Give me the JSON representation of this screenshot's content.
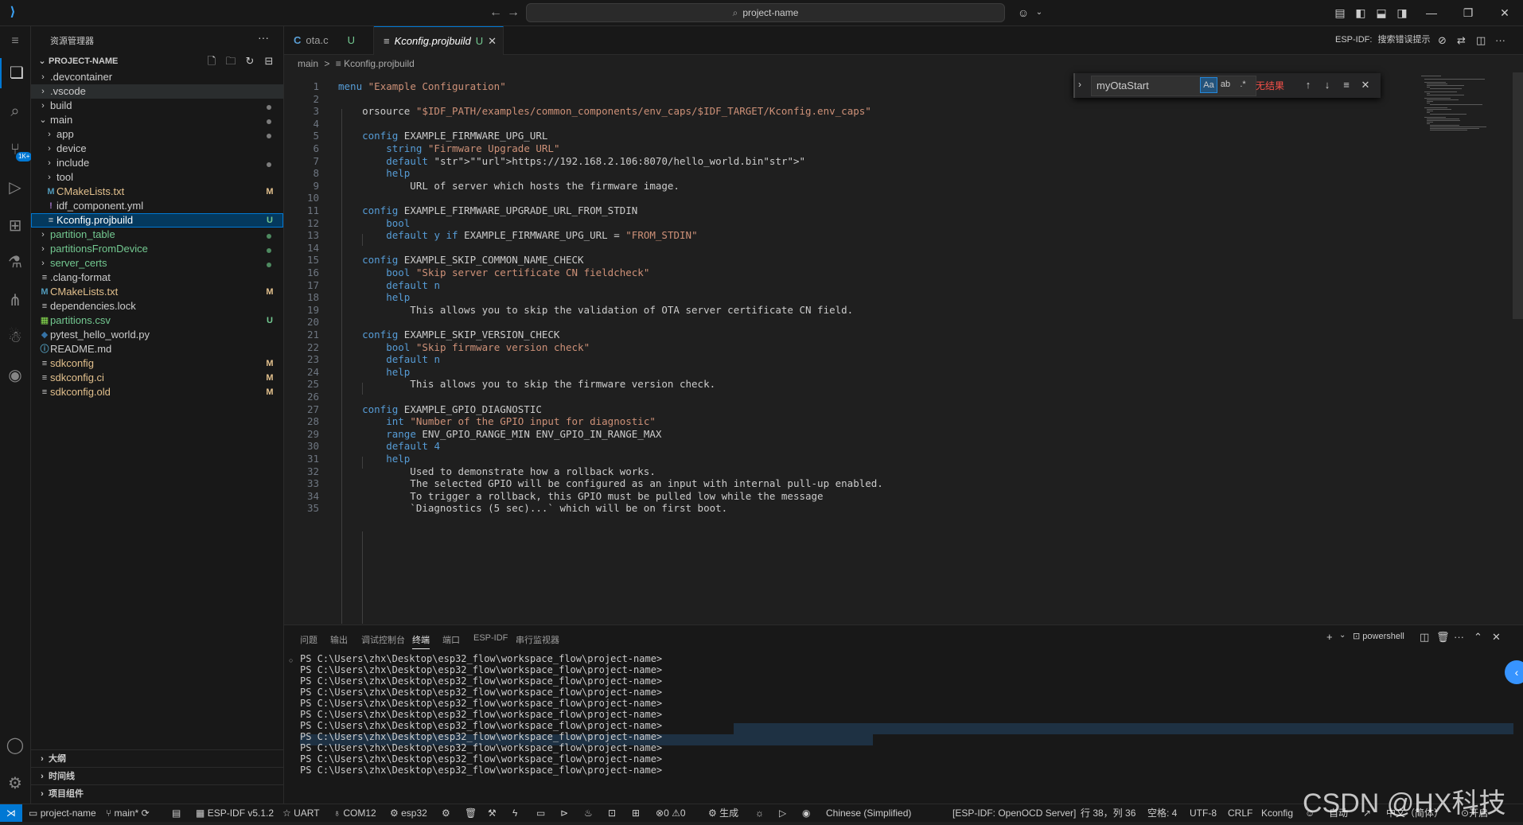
{
  "titlebar": {
    "command_center": "project-name",
    "back": "←",
    "forward": "→"
  },
  "explorer": {
    "title": "资源管理器",
    "more": "···",
    "section": "PROJECT-NAME",
    "items": [
      {
        "label": ".devcontainer",
        "type": "folder",
        "depth": 0
      },
      {
        "label": ".vscode",
        "type": "folder",
        "depth": 0
      },
      {
        "label": "build",
        "type": "folder",
        "depth": 0,
        "status": "dot"
      },
      {
        "label": "main",
        "type": "folder-open",
        "depth": 0,
        "status": "dot"
      },
      {
        "label": "app",
        "type": "folder",
        "depth": 1,
        "status": "dot"
      },
      {
        "label": "device",
        "type": "folder",
        "depth": 1
      },
      {
        "label": "include",
        "type": "folder",
        "depth": 1,
        "status": "dot"
      },
      {
        "label": "tool",
        "type": "folder",
        "depth": 1
      },
      {
        "label": "CMakeLists.txt",
        "type": "cmake",
        "depth": 1,
        "deco": "M"
      },
      {
        "label": "idf_component.yml",
        "type": "yml",
        "depth": 1
      },
      {
        "label": "Kconfig.projbuild",
        "type": "text",
        "depth": 1,
        "deco": "U"
      },
      {
        "label": "partition_table",
        "type": "folder",
        "depth": 0,
        "status": "dot"
      },
      {
        "label": "partitionsFromDevice",
        "type": "folder",
        "depth": 0,
        "status": "dot"
      },
      {
        "label": "server_certs",
        "type": "folder",
        "depth": 0,
        "status": "dot"
      },
      {
        "label": ".clang-format",
        "type": "text",
        "depth": 0
      },
      {
        "label": "CMakeLists.txt",
        "type": "cmake",
        "depth": 0,
        "deco": "M"
      },
      {
        "label": "dependencies.lock",
        "type": "text",
        "depth": 0
      },
      {
        "label": "partitions.csv",
        "type": "csv",
        "depth": 0,
        "deco": "U"
      },
      {
        "label": "pytest_hello_world.py",
        "type": "py",
        "depth": 0
      },
      {
        "label": "README.md",
        "type": "md",
        "depth": 0
      },
      {
        "label": "sdkconfig",
        "type": "text",
        "depth": 0,
        "deco": "M"
      },
      {
        "label": "sdkconfig.ci",
        "type": "text",
        "depth": 0,
        "deco": "M"
      },
      {
        "label": "sdkconfig.old",
        "type": "text",
        "depth": 0,
        "deco": "M"
      }
    ],
    "bottom_sections": [
      "大纲",
      "时间线",
      "项目组件"
    ]
  },
  "tabs": [
    {
      "icon": "C",
      "label": "ota.c",
      "deco": "U"
    },
    {
      "icon": "≡",
      "label": "Kconfig.projbuild",
      "deco": "U",
      "close": "✕"
    }
  ],
  "editor_actions": {
    "label": "ESP-IDF:",
    "hint": "搜索错误提示"
  },
  "breadcrumb": {
    "folder": "main",
    "sep": ">",
    "file": "Kconfig.projbuild"
  },
  "find": {
    "query": "myOtaStart",
    "match_case": "Aa",
    "whole_word": "ab",
    "regex": ".*",
    "result": "无结果"
  },
  "code": {
    "lines": [
      "menu \"Example Configuration\"",
      "",
      "    orsource \"$IDF_PATH/examples/common_components/env_caps/$IDF_TARGET/Kconfig.env_caps\"",
      "",
      "    config EXAMPLE_FIRMWARE_UPG_URL",
      "        string \"Firmware Upgrade URL\"",
      "        default \"https://192.168.2.106:8070/hello_world.bin\"",
      "        help",
      "            URL of server which hosts the firmware image.",
      "",
      "    config EXAMPLE_FIRMWARE_UPGRADE_URL_FROM_STDIN",
      "        bool",
      "        default y if EXAMPLE_FIRMWARE_UPG_URL = \"FROM_STDIN\"",
      "",
      "    config EXAMPLE_SKIP_COMMON_NAME_CHECK",
      "        bool \"Skip server certificate CN fieldcheck\"",
      "        default n",
      "        help",
      "            This allows you to skip the validation of OTA server certificate CN field.",
      "",
      "    config EXAMPLE_SKIP_VERSION_CHECK",
      "        bool \"Skip firmware version check\"",
      "        default n",
      "        help",
      "            This allows you to skip the firmware version check.",
      "",
      "    config EXAMPLE_GPIO_DIAGNOSTIC",
      "        int \"Number of the GPIO input for diagnostic\"",
      "        range ENV_GPIO_RANGE_MIN ENV_GPIO_IN_RANGE_MAX",
      "        default 4",
      "        help",
      "            Used to demonstrate how a rollback works.",
      "            The selected GPIO will be configured as an input with internal pull-up enabled.",
      "            To trigger a rollback, this GPIO must be pulled low while the message",
      "            `Diagnostics (5 sec)...` which will be on first boot."
    ]
  },
  "panel": {
    "tabs": [
      "问题",
      "输出",
      "调试控制台",
      "终端",
      "端口",
      "ESP-IDF",
      "串行监视器"
    ],
    "active_tab": "终端",
    "shell": "powershell",
    "terminal_lines": [
      "PS C:\\Users\\zhx\\Desktop\\esp32_flow\\workspace_flow\\project-name>",
      "PS C:\\Users\\zhx\\Desktop\\esp32_flow\\workspace_flow\\project-name>",
      "PS C:\\Users\\zhx\\Desktop\\esp32_flow\\workspace_flow\\project-name>",
      "PS C:\\Users\\zhx\\Desktop\\esp32_flow\\workspace_flow\\project-name>",
      "PS C:\\Users\\zhx\\Desktop\\esp32_flow\\workspace_flow\\project-name>",
      "PS C:\\Users\\zhx\\Desktop\\esp32_flow\\workspace_flow\\project-name>",
      "PS C:\\Users\\zhx\\Desktop\\esp32_flow\\workspace_flow\\project-name>",
      "PS C:\\Users\\zhx\\Desktop\\esp32_flow\\workspace_flow\\project-name>",
      "PS C:\\Users\\zhx\\Desktop\\esp32_flow\\workspace_flow\\project-name>",
      "PS C:\\Users\\zhx\\Desktop\\esp32_flow\\workspace_flow\\project-name>",
      "PS C:\\Users\\zhx\\Desktop\\esp32_flow\\workspace_flow\\project-name>"
    ]
  },
  "status": {
    "project": "project-name",
    "branch": "main*",
    "idf": "ESP-IDF v5.1.2",
    "uart": "UART",
    "port": "COM12",
    "target": "esp32",
    "problems": "0",
    "warnings": "0",
    "build": "生成",
    "language_pack": "Chinese (Simplified)",
    "openocd": "[ESP-IDF: OpenOCD Server]",
    "cursor": "行 38，列 36",
    "indent": "空格: 4",
    "encoding": "UTF-8",
    "eol": "CRLF",
    "mode": "Kconfig",
    "auto": "自动",
    "ime": "中文（简体）",
    "open": "开启"
  },
  "watermark": "CSDN @HX科技",
  "colors": {
    "accent": "#0078d4",
    "modified": "#e2c08d",
    "untracked": "#73c991",
    "error": "#f85149"
  }
}
